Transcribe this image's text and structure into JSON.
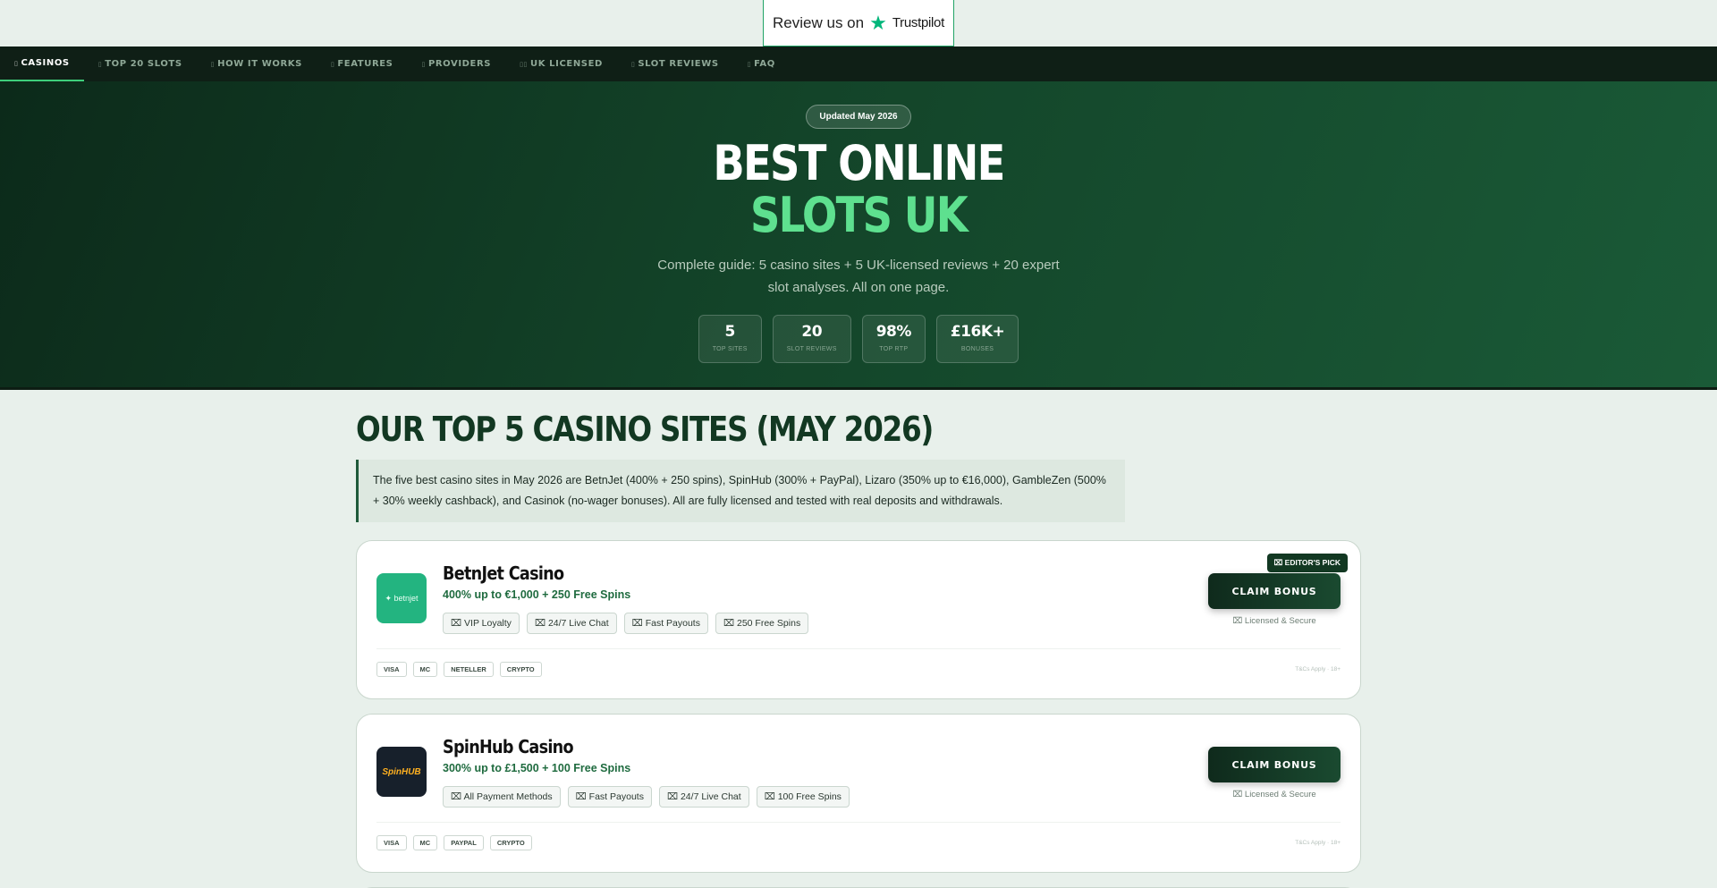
{
  "trustpilot": {
    "label": "Review us on",
    "brand": "Trustpilot",
    "star": "★"
  },
  "nav": [
    {
      "icon": "▯",
      "label": "CASINOS",
      "active": true
    },
    {
      "icon": "▯",
      "label": "TOP 20 SLOTS"
    },
    {
      "icon": "▯",
      "label": "HOW IT WORKS"
    },
    {
      "icon": "▯",
      "label": "FEATURES"
    },
    {
      "icon": "▯",
      "label": "PROVIDERS"
    },
    {
      "icon": "▯▯",
      "label": "UK LICENSED"
    },
    {
      "icon": "▯",
      "label": "SLOT REVIEWS"
    },
    {
      "icon": "▯",
      "label": "FAQ"
    }
  ],
  "hero": {
    "badge": "Updated May 2026",
    "title_line1": "BEST ONLINE",
    "title_line2": "SLOTS UK",
    "subtitle": "Complete guide: 5 casino sites + 5 UK-licensed reviews + 20 expert slot analyses. All on one page.",
    "stats": [
      {
        "value": "5",
        "label": "TOP SITES"
      },
      {
        "value": "20",
        "label": "SLOT REVIEWS"
      },
      {
        "value": "98%",
        "label": "TOP RTP"
      },
      {
        "value": "£16K+",
        "label": "BONUSES"
      }
    ]
  },
  "main": {
    "heading": "OUR TOP 5 CASINO SITES (MAY 2026)",
    "intro": "The five best casino sites in May 2026 are BetnJet (400% + 250 spins), SpinHub (300% + PayPal), Lizaro (350% up to €16,000), GambleZen (500% + 30% weekly cashback), and Casinok (no-wager bonuses). All are fully licensed and tested with real deposits and withdrawals."
  },
  "casinos": [
    {
      "name": "BetnJet Casino",
      "logo_text": "✦ betnjet",
      "offer": "400% up to €1,000 + 250 Free Spins",
      "tags": [
        "⌧ VIP Loyalty",
        "⌧ 24/7 Live Chat",
        "⌧ Fast Payouts",
        "⌧ 250 Free Spins"
      ],
      "cta": "CLAIM BONUS",
      "secure": "⌧ Licensed & Secure",
      "badge": "⌧ EDITOR'S PICK",
      "payments": [
        "VISA",
        "MC",
        "NETELLER",
        "CRYPTO"
      ],
      "tcs": "T&Cs Apply · 18+"
    },
    {
      "name": "SpinHub Casino",
      "logo_text": "SpinHUB",
      "offer": "300% up to £1,500 + 100 Free Spins",
      "tags": [
        "⌧ All Payment Methods",
        "⌧ Fast Payouts",
        "⌧ 24/7 Live Chat",
        "⌧ 100 Free Spins"
      ],
      "cta": "CLAIM BONUS",
      "secure": "⌧ Licensed & Secure",
      "payments": [
        "VISA",
        "MC",
        "PAYPAL",
        "CRYPTO"
      ],
      "tcs": "T&Cs Apply · 18+"
    }
  ]
}
